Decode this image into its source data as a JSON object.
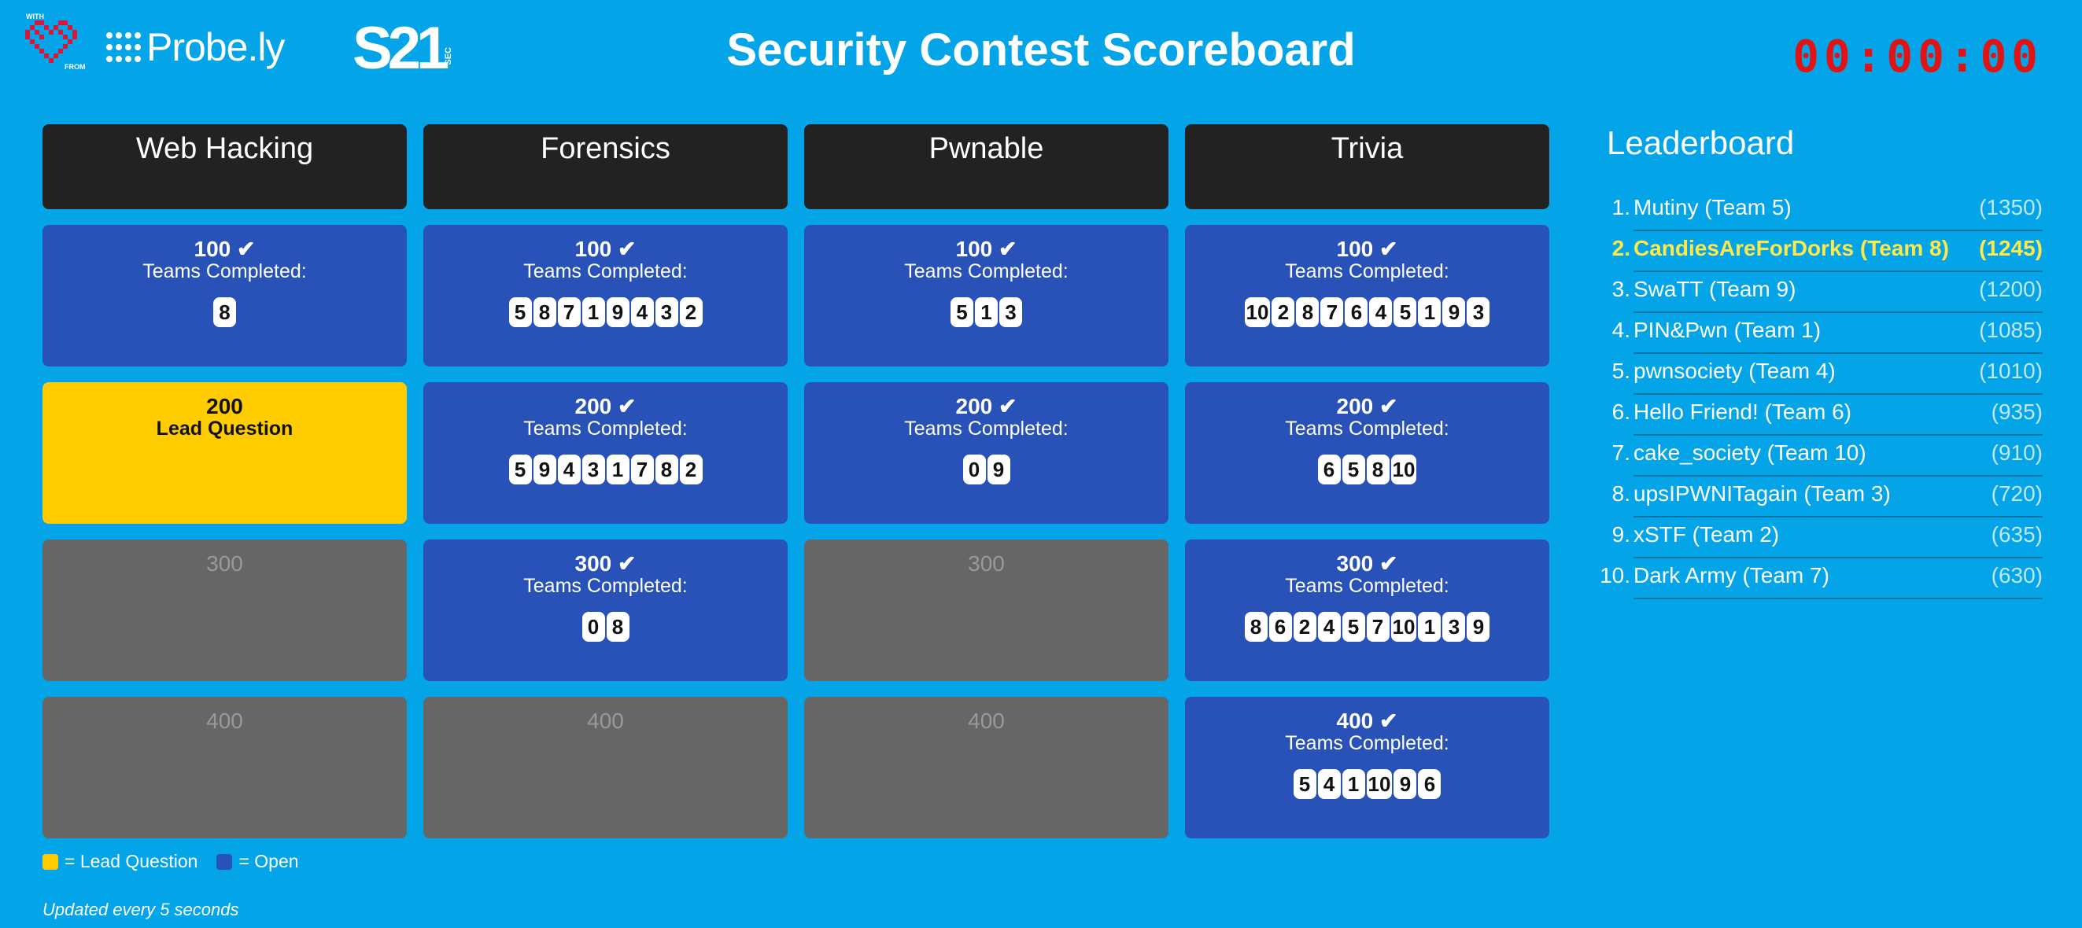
{
  "header": {
    "with_text": "WITH",
    "from_text": "FROM",
    "brand1": "Probe.ly",
    "brand2": "S21",
    "brand2_sub": "SEC",
    "title": "Security Contest Scoreboard",
    "timer": "00:00:00",
    "timer_color": "#e01414"
  },
  "colors": {
    "background": "#04a4e8",
    "open": "#2952b8",
    "lead": "#ffcc00",
    "locked": "#666666",
    "category": "#222222",
    "highlight": "#ffe94a"
  },
  "categories": [
    {
      "name": "Web Hacking",
      "questions": [
        {
          "points": "100 ✔",
          "state": "open",
          "label": "Teams Completed:",
          "teams": [
            "8"
          ]
        },
        {
          "points": "200",
          "state": "lead",
          "label": "Lead Question",
          "teams": []
        },
        {
          "points": "300",
          "state": "locked",
          "label": "",
          "teams": []
        },
        {
          "points": "400",
          "state": "locked",
          "label": "",
          "teams": []
        }
      ]
    },
    {
      "name": "Forensics",
      "questions": [
        {
          "points": "100 ✔",
          "state": "open",
          "label": "Teams Completed:",
          "teams": [
            "5",
            "8",
            "7",
            "1",
            "9",
            "4",
            "3",
            "2"
          ]
        },
        {
          "points": "200 ✔",
          "state": "open",
          "label": "Teams Completed:",
          "teams": [
            "5",
            "9",
            "4",
            "3",
            "1",
            "7",
            "8",
            "2"
          ]
        },
        {
          "points": "300 ✔",
          "state": "open",
          "label": "Teams Completed:",
          "teams": [
            "0",
            "8"
          ]
        },
        {
          "points": "400",
          "state": "locked",
          "label": "",
          "teams": []
        }
      ]
    },
    {
      "name": "Pwnable",
      "questions": [
        {
          "points": "100 ✔",
          "state": "open",
          "label": "Teams Completed:",
          "teams": [
            "5",
            "1",
            "3"
          ]
        },
        {
          "points": "200 ✔",
          "state": "open",
          "label": "Teams Completed:",
          "teams": [
            "0",
            "9"
          ]
        },
        {
          "points": "300",
          "state": "locked",
          "label": "",
          "teams": []
        },
        {
          "points": "400",
          "state": "locked",
          "label": "",
          "teams": []
        }
      ]
    },
    {
      "name": "Trivia",
      "questions": [
        {
          "points": "100 ✔",
          "state": "open",
          "label": "Teams Completed:",
          "teams": [
            "10",
            "2",
            "8",
            "7",
            "6",
            "4",
            "5",
            "1",
            "9",
            "3"
          ]
        },
        {
          "points": "200 ✔",
          "state": "open",
          "label": "Teams Completed:",
          "teams": [
            "6",
            "5",
            "8",
            "10"
          ]
        },
        {
          "points": "300 ✔",
          "state": "open",
          "label": "Teams Completed:",
          "teams": [
            "8",
            "6",
            "2",
            "4",
            "5",
            "7",
            "10",
            "1",
            "3",
            "9"
          ]
        },
        {
          "points": "400 ✔",
          "state": "open",
          "label": "Teams Completed:",
          "teams": [
            "5",
            "4",
            "1",
            "10",
            "9",
            "6"
          ]
        }
      ]
    }
  ],
  "legend": {
    "lead": "= Lead Question",
    "open": "= Open"
  },
  "updated": "Updated every 5 seconds",
  "leaderboard": {
    "title": "Leaderboard",
    "rows": [
      {
        "rank": "1.",
        "name": "Mutiny (Team 5)",
        "score": "(1350)",
        "highlight": false
      },
      {
        "rank": "2.",
        "name": "CandiesAreForDorks (Team 8)",
        "score": "(1245)",
        "highlight": true
      },
      {
        "rank": "3.",
        "name": "SwaTT (Team 9)",
        "score": "(1200)",
        "highlight": false
      },
      {
        "rank": "4.",
        "name": "PIN&Pwn (Team 1)",
        "score": "(1085)",
        "highlight": false
      },
      {
        "rank": "5.",
        "name": "pwnsociety (Team 4)",
        "score": "(1010)",
        "highlight": false
      },
      {
        "rank": "6.",
        "name": "Hello Friend! (Team 6)",
        "score": "(935)",
        "highlight": false
      },
      {
        "rank": "7.",
        "name": "cake_society (Team 10)",
        "score": "(910)",
        "highlight": false
      },
      {
        "rank": "8.",
        "name": "upsIPWNITagain (Team 3)",
        "score": "(720)",
        "highlight": false
      },
      {
        "rank": "9.",
        "name": "xSTF (Team 2)",
        "score": "(635)",
        "highlight": false
      },
      {
        "rank": "10.",
        "name": "Dark Army (Team 7)",
        "score": "(630)",
        "highlight": false
      }
    ]
  }
}
